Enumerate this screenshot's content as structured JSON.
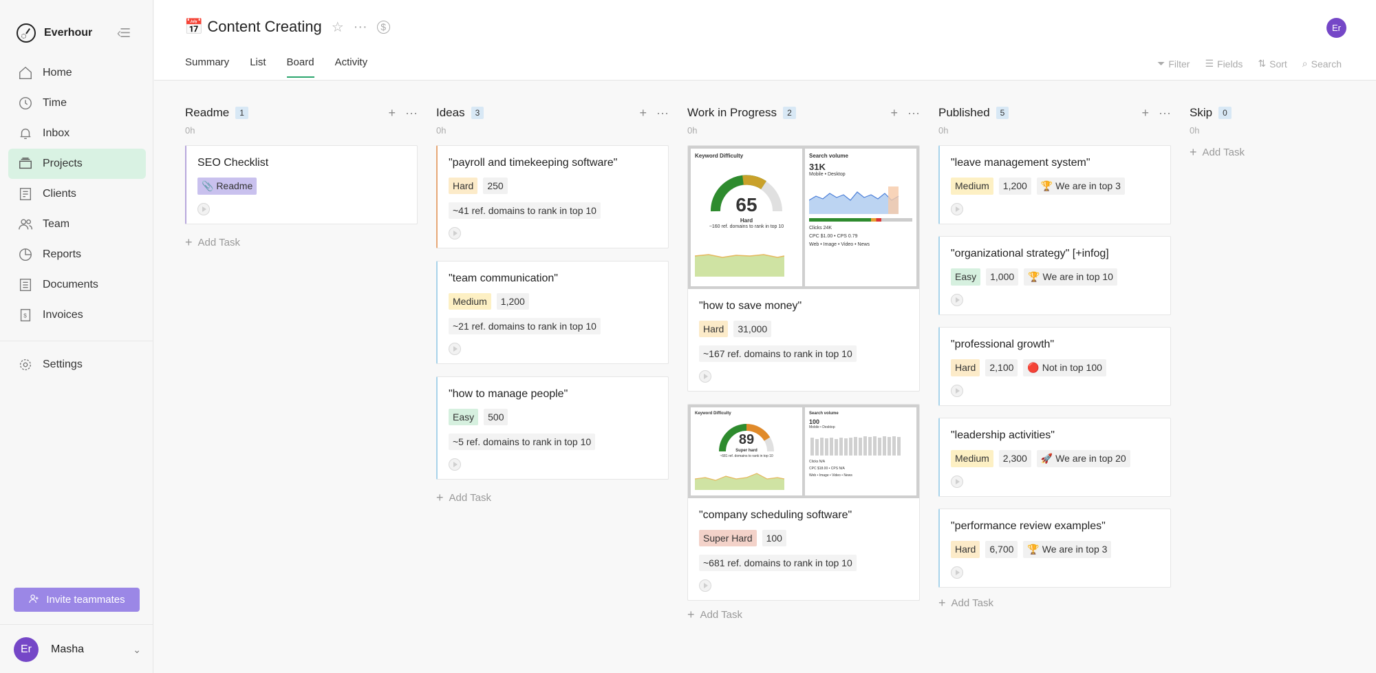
{
  "app": {
    "name": "Everhour"
  },
  "nav": {
    "items": [
      {
        "label": "Home",
        "icon": "home-icon"
      },
      {
        "label": "Time",
        "icon": "clock-icon"
      },
      {
        "label": "Inbox",
        "icon": "bell-icon"
      },
      {
        "label": "Projects",
        "icon": "projects-icon"
      },
      {
        "label": "Clients",
        "icon": "clients-icon"
      },
      {
        "label": "Team",
        "icon": "team-icon"
      },
      {
        "label": "Reports",
        "icon": "reports-icon"
      },
      {
        "label": "Documents",
        "icon": "documents-icon"
      },
      {
        "label": "Invoices",
        "icon": "invoices-icon"
      }
    ],
    "settings": "Settings",
    "invite": "Invite teammates"
  },
  "user": {
    "initials": "Er",
    "name": "Masha"
  },
  "project": {
    "emoji": "📅",
    "title": "Content Creating"
  },
  "tabs": [
    "Summary",
    "List",
    "Board",
    "Activity"
  ],
  "tools": {
    "filter": "Filter",
    "fields": "Fields",
    "sort": "Sort",
    "search": "Search"
  },
  "columns": [
    {
      "title": "Readme",
      "count": "1",
      "hours": "0h",
      "add": "Add Task",
      "cards": [
        {
          "title": "SEO Checklist",
          "tag": "📎 Readme"
        }
      ]
    },
    {
      "title": "Ideas",
      "count": "3",
      "hours": "0h",
      "add": "Add Task",
      "cards": [
        {
          "title": "\"payroll and timekeeping software\"",
          "level": "Hard",
          "volume": "250",
          "note": "~41 ref. domains to rank in top 10"
        },
        {
          "title": "\"team communication\"",
          "level": "Medium",
          "volume": "1,200",
          "note": "~21 ref. domains to rank in top 10"
        },
        {
          "title": "\"how to manage people\"",
          "level": "Easy",
          "volume": "500",
          "note": "~5 ref. domains to rank in top 10"
        }
      ]
    },
    {
      "title": "Work in Progress",
      "count": "2",
      "hours": "0h",
      "add": "Add Task",
      "cards": [
        {
          "title": "\"how to save money\"",
          "level": "Hard",
          "volume": "31,000",
          "note": "~167 ref. domains to rank in top 10",
          "img": {
            "kd_label": "Keyword Difficulty",
            "kd_value": "65",
            "kd_text": "Hard",
            "kd_sub": "~160 ref. domains to rank in top 10",
            "sv_label": "Search volume",
            "sv_value": "31K",
            "sv_sub": "Mobile • Desktop",
            "clicks": "Clicks 24K",
            "cpc": "CPC $1.00 • CPS 0.79",
            "serp": "Web • Image • Video • News"
          }
        },
        {
          "title": "\"company scheduling software\"",
          "level": "Super Hard",
          "volume": "100",
          "note": "~681 ref. domains to rank in top 10",
          "img": {
            "kd_label": "Keyword Difficulty",
            "kd_value": "89",
            "kd_text": "Super hard",
            "kd_sub": "~681 ref. domains to rank in top 10",
            "sv_label": "Search volume",
            "sv_value": "100",
            "sv_sub": "Mobile • Desktop",
            "clicks": "Clicks N/A",
            "cpc": "CPC $18.00 • CPS N/A",
            "serp": "Web • Image • Video • News"
          }
        }
      ]
    },
    {
      "title": "Published",
      "count": "5",
      "hours": "0h",
      "add": "Add Task",
      "cards": [
        {
          "title": "\"leave management system\"",
          "level": "Medium",
          "volume": "1,200",
          "rank": "🏆 We are in top 3"
        },
        {
          "title": "\"organizational strategy\" [+infog]",
          "level": "Easy",
          "volume": "1,000",
          "rank": "🏆 We are in top 10"
        },
        {
          "title": "\"professional growth\"",
          "level": "Hard",
          "volume": "2,100",
          "rank": "🔴 Not in top 100"
        },
        {
          "title": "\"leadership activities\"",
          "level": "Medium",
          "volume": "2,300",
          "rank": "🚀 We are in top 20"
        },
        {
          "title": "\"performance review examples\"",
          "level": "Hard",
          "volume": "6,700",
          "rank": "🏆 We are in top 3"
        }
      ]
    },
    {
      "title": "Skip",
      "count": "0",
      "hours": "0h",
      "add": "Add Task",
      "cards": []
    }
  ]
}
